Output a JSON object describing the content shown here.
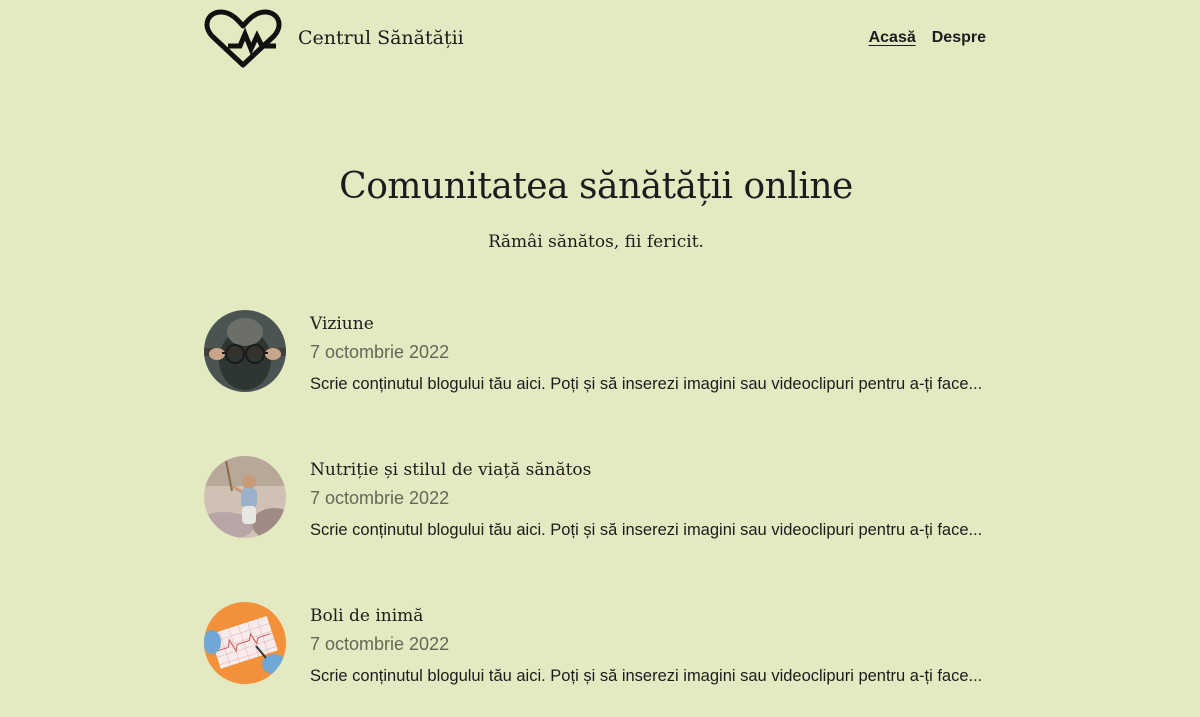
{
  "site": {
    "title": "Centrul Sănătății",
    "logo_icon": "heart-pulse-icon"
  },
  "nav": {
    "items": [
      {
        "label": "Acasă",
        "active": true
      },
      {
        "label": "Despre",
        "active": false
      }
    ]
  },
  "hero": {
    "title": "Comunitatea sănătății online",
    "subtitle": "Rămâi sănătos, fii fericit."
  },
  "posts": [
    {
      "title": "Viziune",
      "date": "7 octombrie 2022",
      "excerpt": "Scrie conținutul blogului tău aici. Poți și să inserezi imagini sau videoclipuri pentru a-ți face...",
      "thumb": "glasses-photo"
    },
    {
      "title": "Nutriție și stilul de viață sănătos",
      "date": "7 octombrie 2022",
      "excerpt": "Scrie conținutul blogului tău aici. Poți și să inserezi imagini sau videoclipuri pentru a-ți face...",
      "thumb": "child-photo"
    },
    {
      "title": "Boli de inimă",
      "date": "7 octombrie 2022",
      "excerpt": "Scrie conținutul blogului tău aici. Poți și să inserezi imagini sau videoclipuri pentru a-ți face...",
      "thumb": "ecg-photo"
    }
  ],
  "colors": {
    "background": "#e3eac2",
    "text": "#1c1c1c",
    "muted": "#666658"
  }
}
